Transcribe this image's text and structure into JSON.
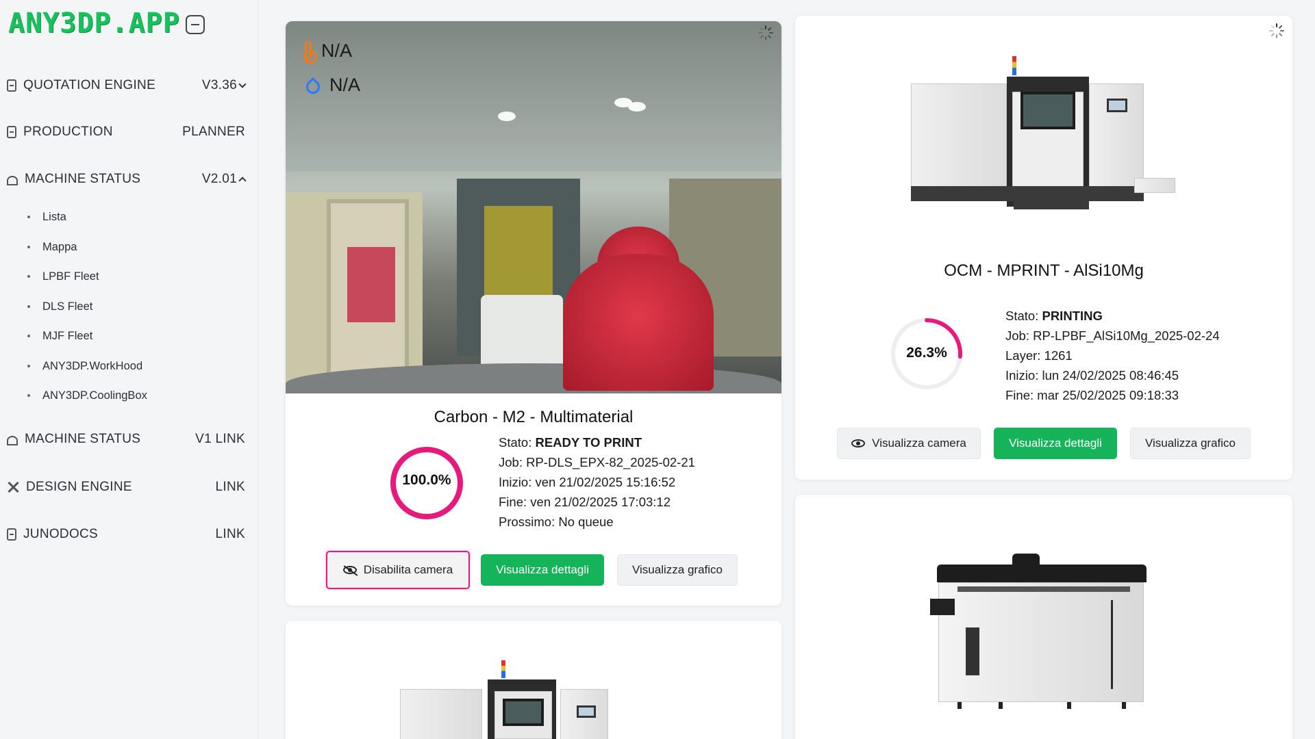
{
  "brand": {
    "logo": "ANY3DP.APP",
    "accent": "#19c15d",
    "pink": "#e6197c"
  },
  "sidebar": {
    "items": [
      {
        "icon": "document-icon",
        "label": "QUOTATION ENGINE",
        "right": "V3.36",
        "chevron": "down"
      },
      {
        "icon": "document-icon",
        "label": "PRODUCTION",
        "right": "PLANNER"
      },
      {
        "icon": "gauge-icon",
        "label": "MACHINE STATUS",
        "right": "V2.01",
        "chevron": "up"
      },
      {
        "icon": "gauge-icon",
        "label": "MACHINE STATUS",
        "right": "V1 LINK"
      },
      {
        "icon": "tools-icon",
        "label": "DESIGN ENGINE",
        "right": "LINK"
      },
      {
        "icon": "document-icon",
        "label": "JUNODOCS",
        "right": "LINK"
      }
    ],
    "sub_items": [
      "Lista",
      "Mappa",
      "LPBF Fleet",
      "DLS Fleet",
      "MJF Fleet",
      "ANY3DP.WorkHood",
      "ANY3DP.CoolingBox"
    ]
  },
  "cards": {
    "carbon": {
      "camera": {
        "temperature": "N/A",
        "humidity": "N/A"
      },
      "title": "Carbon - M2 - Multimaterial",
      "progress_label": "100.0%",
      "progress": 1.0,
      "stato_label": "Stato:",
      "stato": "READY TO PRINT",
      "job_label": "Job:",
      "job": "RP-DLS_EPX-82_2025-02-21",
      "inizio_label": "Inizio:",
      "inizio": "ven 21/02/2025 15:16:52",
      "fine_label": "Fine:",
      "fine": "ven 21/02/2025 17:03:12",
      "prossimo_label": "Prossimo:",
      "prossimo": "No queue",
      "btn_camera": "Disabilita camera",
      "btn_details": "Visualizza dettagli",
      "btn_chart": "Visualizza grafico"
    },
    "ocm": {
      "title": "OCM - MPRINT - AlSi10Mg",
      "progress_label": "26.3%",
      "progress": 0.263,
      "stato_label": "Stato:",
      "stato": "PRINTING",
      "job_label": "Job:",
      "job": "RP-LPBF_AlSi10Mg_2025-02-24",
      "layer_label": "Layer:",
      "layer": "1261",
      "inizio_label": "Inizio:",
      "inizio": "lun 24/02/2025 08:46:45",
      "fine_label": "Fine:",
      "fine": "mar 25/02/2025 09:18:33",
      "btn_camera": "Visualizza camera",
      "btn_details": "Visualizza dettagli",
      "btn_chart": "Visualizza grafico"
    }
  }
}
